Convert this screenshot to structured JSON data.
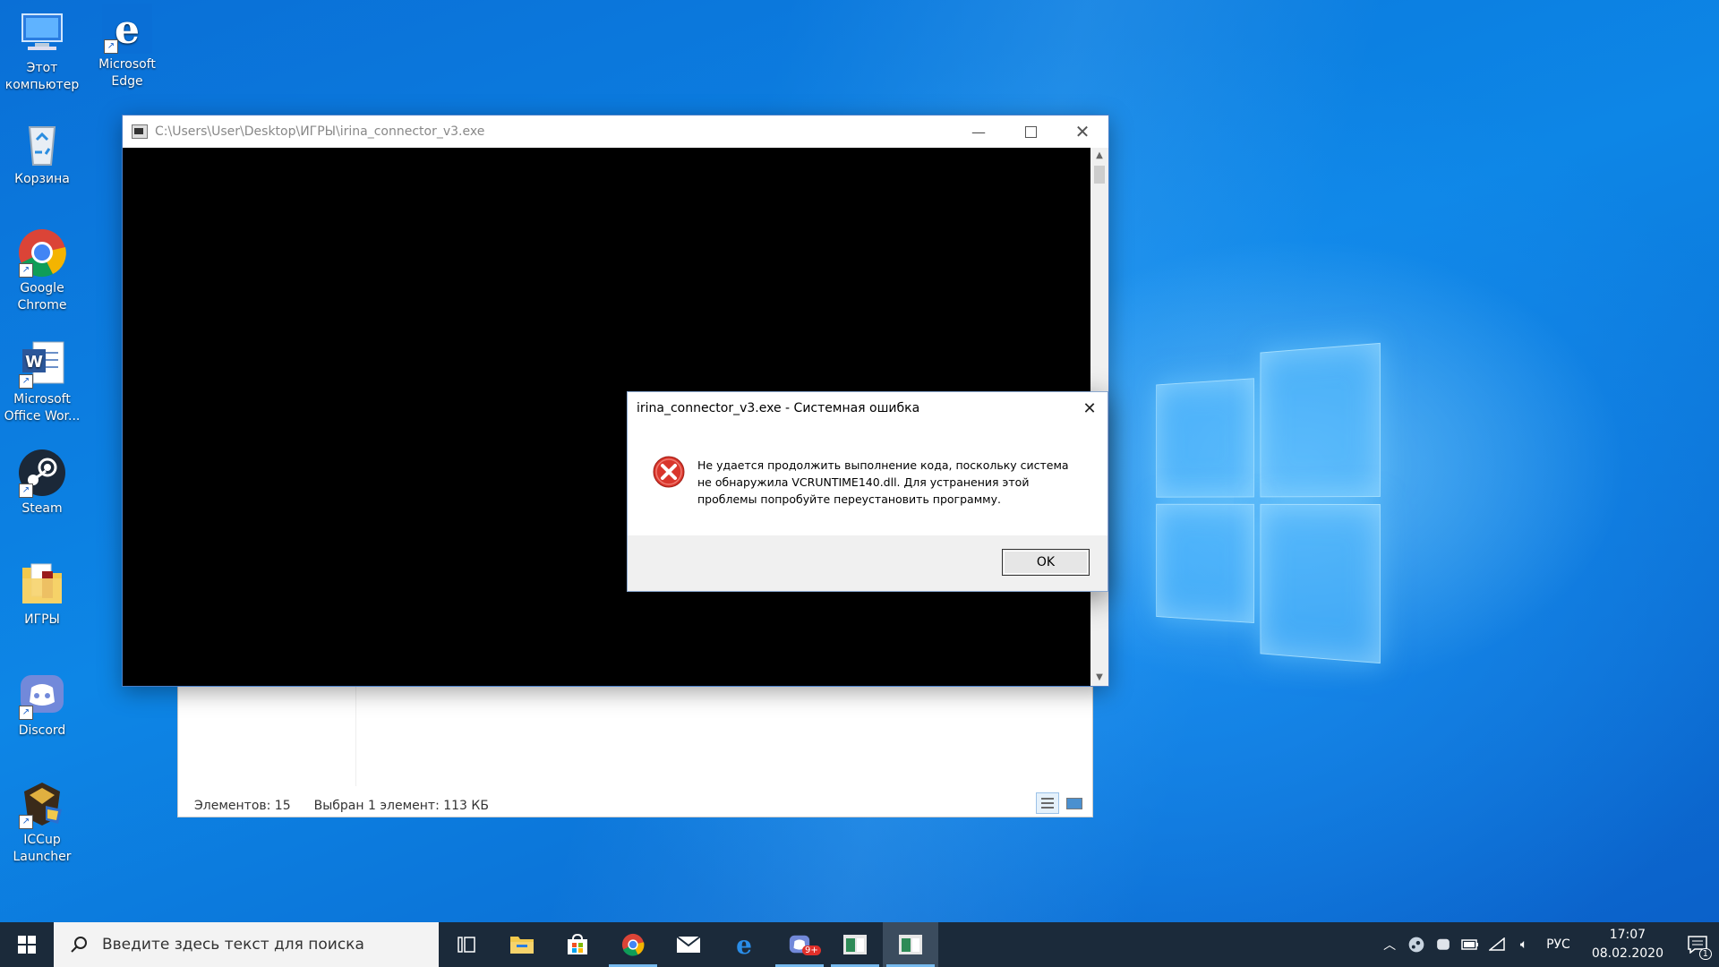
{
  "desktop": {
    "icons": [
      {
        "label": "Этот компьютер"
      },
      {
        "label": "Microsoft Edge"
      },
      {
        "label": "Корзина"
      },
      {
        "label": "Google Chrome"
      },
      {
        "label": "Microsoft Office Wor..."
      },
      {
        "label": "Steam"
      },
      {
        "label": "ИГРЫ"
      },
      {
        "label": "Discord"
      },
      {
        "label": "ICCup Launcher"
      }
    ]
  },
  "console_window": {
    "title": "C:\\Users\\User\\Desktop\\ИГРЫ\\irina_connector_v3.exe"
  },
  "explorer": {
    "items_count": "Элементов: 15",
    "selected": "Выбран 1 элемент: 113 КБ"
  },
  "error_dialog": {
    "title": "irina_connector_v3.exe - Системная ошибка",
    "message": "Не удается продолжить выполнение кода, поскольку система не обнаружила VCRUNTIME140.dll. Для устранения этой проблемы попробуйте переустановить программу.",
    "ok_label": "OK"
  },
  "taskbar": {
    "search_placeholder": "Введите здесь текст для поиска",
    "discord_badge": "9+",
    "language": "РУС",
    "time": "17:07",
    "date": "08.02.2020",
    "notification_count": "1"
  },
  "colors": {
    "accent": "#0078d7",
    "taskbar": "#1b2a3a",
    "error_red": "#d9362c"
  }
}
